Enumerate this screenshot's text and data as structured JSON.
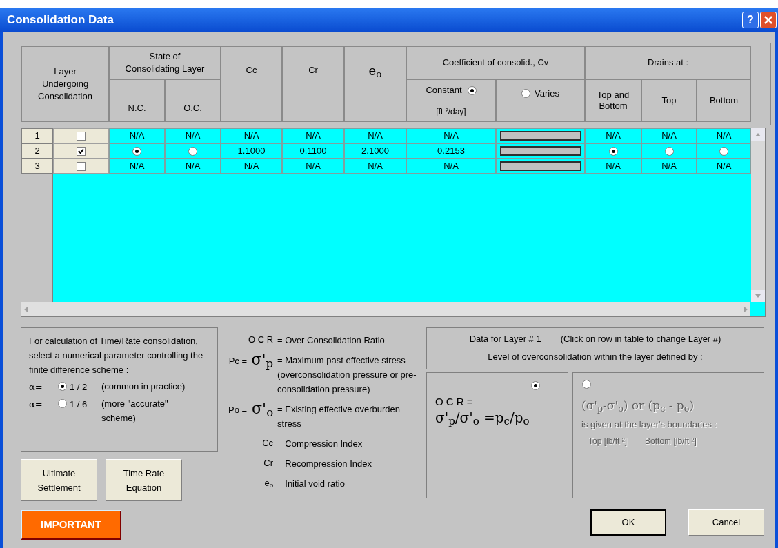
{
  "window": {
    "title": "Consolidation Data",
    "help": "?"
  },
  "header": {
    "layer": "Layer Undergoing Consolidation",
    "state": "State of Consolidating Layer",
    "nc": "N.C.",
    "oc": "O.C.",
    "cc": "Cc",
    "cr": "Cr",
    "eo": "e$_{o}$",
    "cv": "Coefficient of consolid., Cv",
    "constant": {
      "label": "Constant",
      "selected": true
    },
    "units": "[ft ²/day]",
    "varies": {
      "label": "Varies",
      "selected": false
    },
    "drains": "Drains at :",
    "top_bottom": "Top and Bottom",
    "top": "Top",
    "bottom": "Bottom"
  },
  "rows": [
    {
      "number": "1",
      "checked": false,
      "cells": [
        {
          "kind": "text",
          "text": "N/A"
        },
        {
          "kind": "text",
          "text": "N/A"
        },
        {
          "kind": "text",
          "text": "N/A"
        },
        {
          "kind": "text",
          "text": "N/A"
        },
        {
          "kind": "text",
          "text": "N/A"
        },
        {
          "kind": "text",
          "text": "N/A"
        },
        {
          "kind": "bar"
        },
        {
          "kind": "text",
          "text": "N/A"
        },
        {
          "kind": "text",
          "text": "N/A"
        },
        {
          "kind": "text",
          "text": "N/A"
        }
      ]
    },
    {
      "number": "2",
      "checked": true,
      "cells": [
        {
          "kind": "radio",
          "selected": true
        },
        {
          "kind": "radio",
          "selected": false
        },
        {
          "kind": "text",
          "text": "1.1000"
        },
        {
          "kind": "text",
          "text": "0.1100"
        },
        {
          "kind": "text",
          "text": "2.1000"
        },
        {
          "kind": "text",
          "text": "0.2153"
        },
        {
          "kind": "bar"
        },
        {
          "kind": "radio",
          "selected": true
        },
        {
          "kind": "radio",
          "selected": false
        },
        {
          "kind": "radio",
          "selected": false
        }
      ]
    },
    {
      "number": "3",
      "checked": false,
      "cells": [
        {
          "kind": "text",
          "text": "N/A"
        },
        {
          "kind": "text",
          "text": "N/A"
        },
        {
          "kind": "text",
          "text": "N/A"
        },
        {
          "kind": "text",
          "text": "N/A"
        },
        {
          "kind": "text",
          "text": "N/A"
        },
        {
          "kind": "text",
          "text": "N/A"
        },
        {
          "kind": "bar"
        },
        {
          "kind": "text",
          "text": "N/A"
        },
        {
          "kind": "text",
          "text": "N/A"
        },
        {
          "kind": "text",
          "text": "N/A"
        }
      ]
    }
  ],
  "scheme": {
    "text": "For calculation of Time/Rate consolidation, select a numerical parameter controlling the finite difference scheme :",
    "options": [
      {
        "label": "α=",
        "value": "1 / 2",
        "note": "(common in practice)",
        "selected": true
      },
      {
        "label": "α=",
        "value": "1 / 6",
        "note": "(more \"accurate\" scheme)",
        "selected": false
      }
    ]
  },
  "buttons": [
    "Ultimate Settlement",
    "Time Rate Equation"
  ],
  "important": "IMPORTANT",
  "legend": [
    {
      "symbol": "O C R",
      "text": "= Over Consolidation Ratio"
    },
    {
      "label": "Pc =",
      "symbol": "σ'$_{p}$",
      "text": "= Maximum past effective stress (overconsolidation pressure or pre-consolidation pressure)"
    },
    {
      "label": "Po =",
      "symbol": "σ'$_{o}$",
      "text": "= Existing effective overburden stress"
    },
    {
      "symbol": "Cc",
      "text": "= Compression Index"
    },
    {
      "symbol": "Cr",
      "text": "= Recompression Index"
    },
    {
      "symbol": "e$_{o}$",
      "text": "= Initial void ratio"
    }
  ],
  "layer_panel": {
    "title": "Data for Layer # 1",
    "hint": "(Click on row in table to change Layer #)",
    "subtitle": "Level of overconsolidation within the layer defined by :",
    "options": [
      {
        "kind": "ratio",
        "selected": true,
        "disabled": false,
        "label": "O C R =",
        "formula": "σ'$_{p}$/σ'$_{o}$ =p$_{c}$/p$_{o}$"
      },
      {
        "kind": "difference",
        "selected": false,
        "disabled": true,
        "formula": "(σ'$_{p}$-σ'$_{o}$) or (p$_{c}$ - p$_{o}$)",
        "label": "is given at the layer's boundaries :",
        "fields": [
          "Top [lb/ft ²]",
          "Bottom [lb/ft ²]"
        ]
      }
    ]
  },
  "dialog_buttons": [
    "OK",
    "Cancel"
  ]
}
